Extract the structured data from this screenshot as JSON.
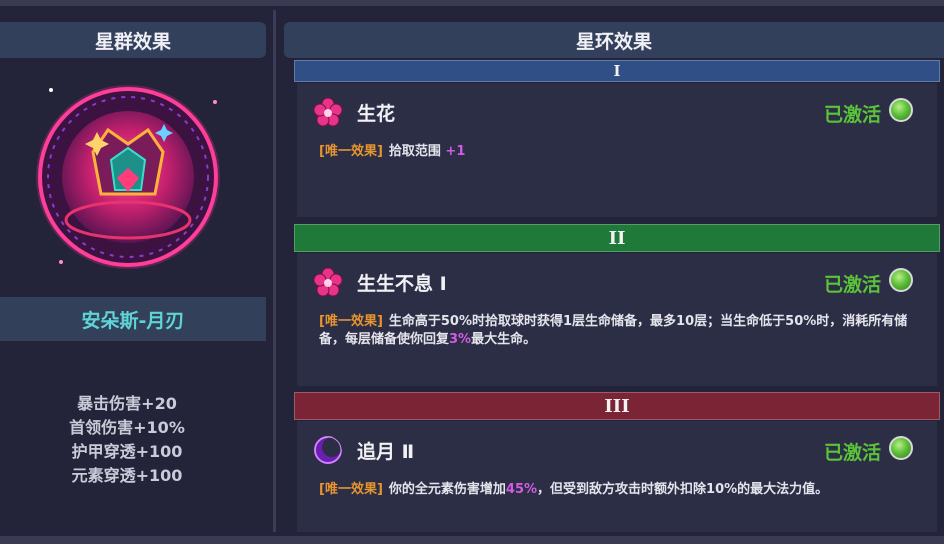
{
  "left_panel": {
    "title": "星群效果",
    "constellation_name": "安朵斯-月刃",
    "stats": [
      "暴击伤害+20",
      "首领伤害+10%",
      "护甲穿透+100",
      "元素穿透+100"
    ]
  },
  "right_panel": {
    "title": "星环效果",
    "tiers": [
      {
        "numeral": "I",
        "color": "#2f4f86",
        "effect": {
          "icon": "pink-flower-icon",
          "name": "生花",
          "status": "已激活",
          "tag": "[唯一效果]",
          "desc_parts": [
            "拾取范围 ",
            "+1",
            ""
          ]
        }
      },
      {
        "numeral": "II",
        "color": "#1f7a3a",
        "effect": {
          "icon": "pink-flower-icon",
          "name": "生生不息 Ⅰ",
          "status": "已激活",
          "tag": "[唯一效果]",
          "desc_parts": [
            "生命高于50%时拾取球时获得1层生命储备，最多10层；当生命低于50%时，消耗所有储备，每层储备使你回复",
            "3%",
            "最大生命。"
          ]
        }
      },
      {
        "numeral": "III",
        "color": "#7a2435",
        "effect": {
          "icon": "purple-moon-icon",
          "name": "追月 Ⅱ",
          "status": "已激活",
          "tag": "[唯一效果]",
          "desc_parts": [
            "你的全元素伤害增加",
            "45%",
            "，但受到敌方攻击时额外扣除10%的最大法力值。"
          ]
        }
      }
    ]
  },
  "colors": {
    "status_green": "#5ac33a",
    "tag_orange": "#e8952f",
    "highlight_purple": "#d35be3",
    "name_cyan": "#5fd4d6"
  }
}
